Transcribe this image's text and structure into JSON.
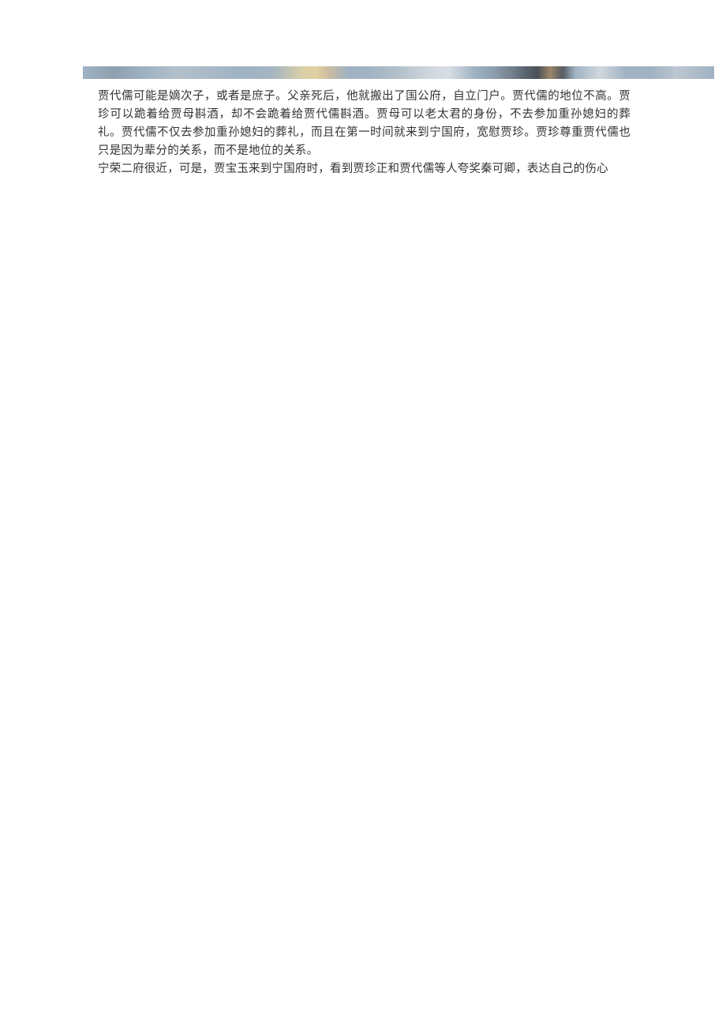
{
  "content": {
    "paragraphs": [
      "贾代儒可能是嫡次子，或者是庶子。父亲死后，他就搬出了国公府，自立门户。贾代儒的地位不高。贾珍可以跪着给贾母斟酒，却不会跪着给贾代儒斟酒。贾母可以老太君的身份，不去参加重孙媳妇的葬礼。贾代儒不仅去参加重孙媳妇的葬礼，而且在第一时间就来到宁国府，宽慰贾珍。贾珍尊重贾代儒也只是因为辈分的关系，而不是地位的关系。",
      "宁荣二府很近，可是，贾宝玉来到宁国府时，看到贾珍正和贾代儒等人夸奖秦可卿，表达自己的伤心"
    ]
  }
}
